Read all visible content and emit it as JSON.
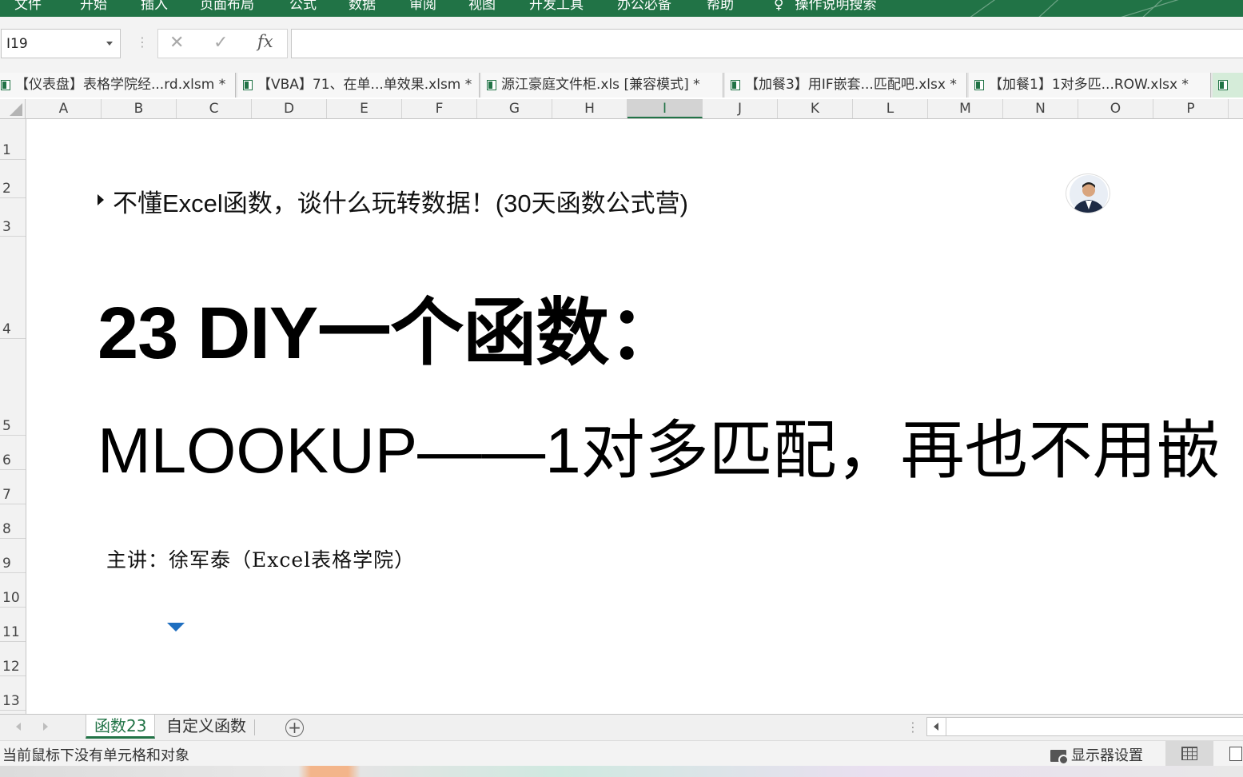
{
  "ribbon": {
    "tabs": [
      "文件",
      "开始",
      "插入",
      "页面布局",
      "公式",
      "数据",
      "审阅",
      "视图",
      "开发工具",
      "办公必备",
      "帮助",
      "操作说明搜索"
    ],
    "color": "#217346"
  },
  "formula_bar": {
    "name_box": "I19",
    "formula": ""
  },
  "workbooks": [
    {
      "label": "【仪表盘】表格学院经...rd.xlsm *",
      "active": false
    },
    {
      "label": "【VBA】71、在单...单效果.xlsm *",
      "active": false
    },
    {
      "label": "源江豪庭文件柜.xls  [兼容模式] *",
      "active": false
    },
    {
      "label": "【加餐3】用IF嵌套...匹配吧.xlsx *",
      "active": false
    },
    {
      "label": "【加餐1】1对多匹...ROW.xlsx *",
      "active": false
    },
    {
      "label": "",
      "active": true
    }
  ],
  "columns": [
    "A",
    "B",
    "C",
    "D",
    "E",
    "F",
    "G",
    "H",
    "I",
    "J",
    "K",
    "L",
    "M",
    "N",
    "O",
    "P"
  ],
  "selected_column": "I",
  "rows": [
    "1",
    "2",
    "3",
    "4",
    "5",
    "6",
    "7",
    "8",
    "9",
    "10",
    "11",
    "12",
    "13"
  ],
  "content": {
    "subtitle": "不懂Excel函数，谈什么玩转数据！(30天函数公式营)",
    "title": "23 DIY一个函数：",
    "title2": "MLOOKUP——1对多匹配，再也不用嵌",
    "presenter": "主讲：徐军泰（Excel表格学院）"
  },
  "sheets": [
    {
      "label": "函数23",
      "active": true
    },
    {
      "label": "自定义函数",
      "active": false
    }
  ],
  "status": {
    "message": "当前鼠标下没有单元格和对象",
    "display_settings": "显示器设置"
  }
}
